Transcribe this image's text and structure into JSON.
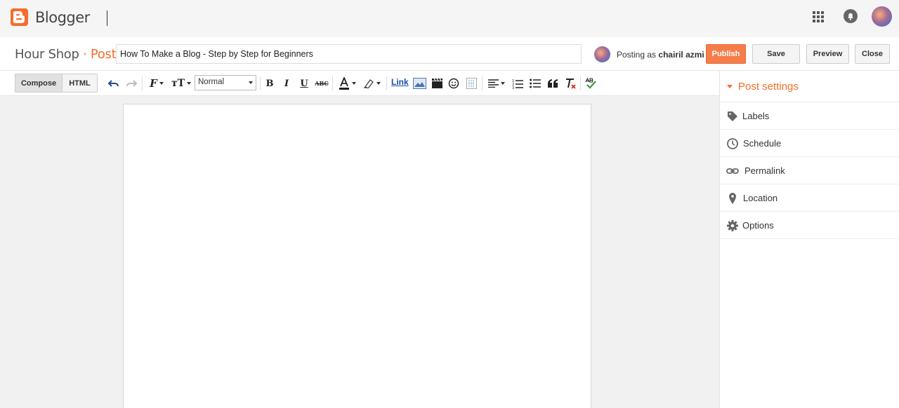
{
  "app": {
    "brand": "Blogger"
  },
  "post_header": {
    "blog_name": "Hour Shop",
    "separator": "·",
    "section": "Post",
    "title_value": "How To Make a Blog - Step by Step for Beginners",
    "posting_as_prefix": "Posting as",
    "posting_as_user": "chairil azmi",
    "buttons": {
      "publish": "Publish",
      "save": "Save",
      "preview": "Preview",
      "close": "Close"
    }
  },
  "toolbar": {
    "mode_compose": "Compose",
    "mode_html": "HTML",
    "format_value": "Normal",
    "link_label": "Link",
    "icons": [
      "undo-icon",
      "redo-icon",
      "font-family-icon",
      "font-size-icon",
      "bold-icon",
      "italic-icon",
      "underline-icon",
      "strikethrough-icon",
      "text-color-icon",
      "highlight-icon",
      "link",
      "image-icon",
      "video-icon",
      "emoji-icon",
      "jump-break-icon",
      "align-icon",
      "numbered-list-icon",
      "bullet-list-icon",
      "quote-icon",
      "clear-formatting-icon",
      "spellcheck-icon"
    ],
    "bold": "B",
    "italic": "I",
    "underline": "U",
    "strike": "ABC"
  },
  "side_panel": {
    "title": "Post settings",
    "items": [
      {
        "label": "Labels",
        "icon": "tag-icon"
      },
      {
        "label": "Schedule",
        "icon": "clock-icon"
      },
      {
        "label": "Permalink",
        "icon": "link-icon"
      },
      {
        "label": "Location",
        "icon": "pin-icon"
      },
      {
        "label": "Options",
        "icon": "gear-icon"
      }
    ]
  },
  "colors": {
    "accent": "#f56d2a",
    "publish_bg": "#f57d4a",
    "link": "#1a4fa3"
  }
}
